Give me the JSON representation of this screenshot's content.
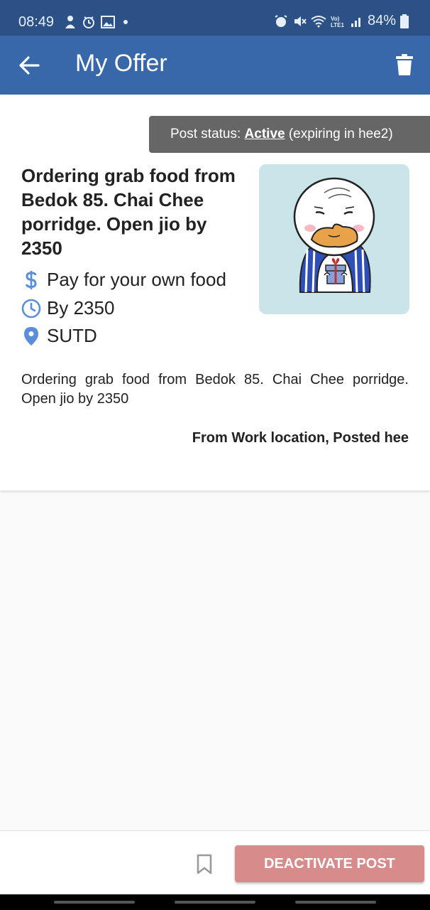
{
  "status_bar": {
    "time": "08:49",
    "battery": "84%",
    "left_icons": [
      "person-icon",
      "timer-icon",
      "image-icon",
      "dot-icon"
    ],
    "right_icons": [
      "alarm-icon",
      "mute-icon",
      "wifi-icon",
      "volte-icon",
      "signal-icon",
      "battery-icon"
    ]
  },
  "app_bar": {
    "title": "My Offer",
    "back_icon": "arrow-left-icon",
    "delete_icon": "trash-icon"
  },
  "post": {
    "status_label": "Post status: ",
    "status_value": "Active",
    "status_suffix": " (expiring in hee2)",
    "title": "Ordering grab food from Bedok 85. Chai Chee porridge. Open jio by 2350",
    "payment": "Pay for your own food",
    "time": "By 2350",
    "location": "SUTD",
    "description": "Ordering grab food from Bedok 85. Chai Chee porridge. Open jio by 2350",
    "from_line": "From Work location, Posted hee",
    "avatar": "duck-with-gift-icon"
  },
  "bottom_bar": {
    "bookmark_icon": "bookmark-icon",
    "deactivate_label": "DEACTIVATE POST"
  },
  "colors": {
    "status_bar": "#2c5187",
    "app_bar": "#3868aa",
    "accent_icon": "#5b8ed8",
    "status_pill": "#666666",
    "deactivate_button": "#d78b8b",
    "avatar_bg": "#c9e5e9"
  }
}
